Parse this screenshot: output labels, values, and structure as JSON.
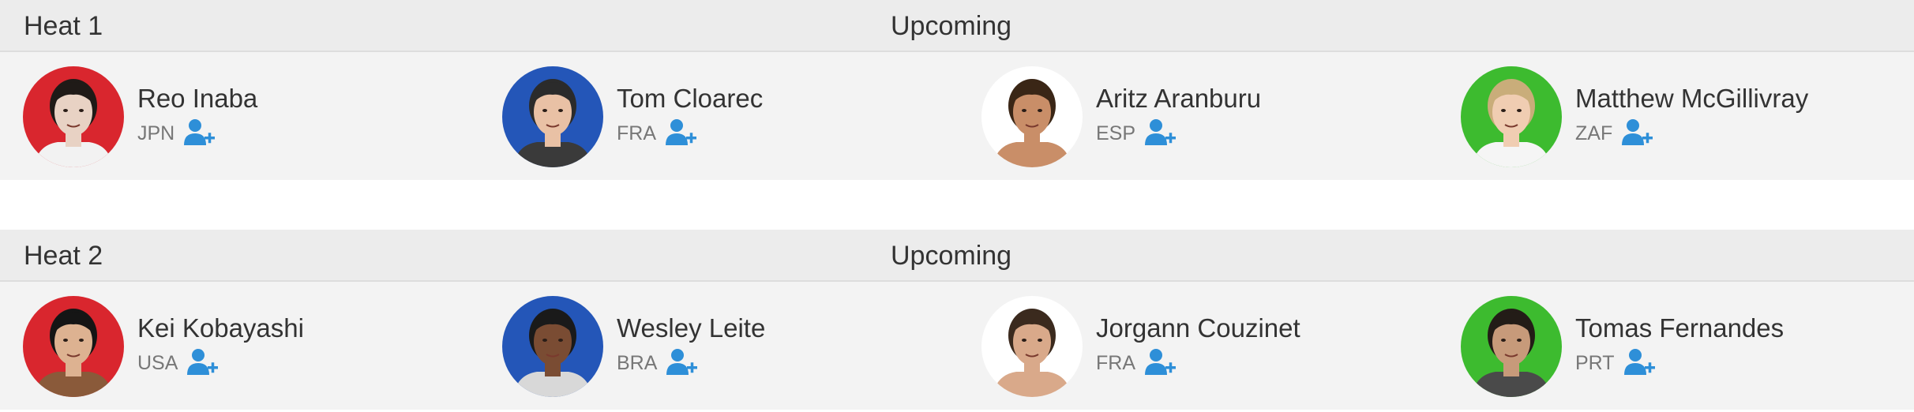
{
  "heats": [
    {
      "title": "Heat 1",
      "status": "Upcoming",
      "athletes": [
        {
          "name": "Reo Inaba",
          "country": "JPN",
          "jersey_color": "#d9262e",
          "avatar_bg": "#d9262e",
          "skin": "#e8d2c4",
          "hair": "#1f1a17",
          "shirt": "#f2f2f2"
        },
        {
          "name": "Tom Cloarec",
          "country": "FRA",
          "jersey_color": "#2456b8",
          "avatar_bg": "#2456b8",
          "skin": "#e9c1a5",
          "hair": "#2b2b2b",
          "shirt": "#3a3a3a"
        },
        {
          "name": "Aritz Aranburu",
          "country": "ESP",
          "jersey_color": "#ffffff",
          "avatar_bg": "#ffffff",
          "skin": "#c98e68",
          "hair": "#3a2616",
          "shirt": "#c98e68"
        },
        {
          "name": "Matthew McGillivray",
          "country": "ZAF",
          "jersey_color": "#3dbb2f",
          "avatar_bg": "#3dbb2f",
          "skin": "#f0cdb2",
          "hair": "#c9ad7a",
          "shirt": "#f5f5f5"
        }
      ]
    },
    {
      "title": "Heat 2",
      "status": "Upcoming",
      "athletes": [
        {
          "name": "Kei Kobayashi",
          "country": "USA",
          "jersey_color": "#d9262e",
          "avatar_bg": "#d9262e",
          "skin": "#ddb291",
          "hair": "#151515",
          "shirt": "#8a5a3a"
        },
        {
          "name": "Wesley Leite",
          "country": "BRA",
          "jersey_color": "#2456b8",
          "avatar_bg": "#2456b8",
          "skin": "#7a4c33",
          "hair": "#1a1a1a",
          "shirt": "#d8d8d8"
        },
        {
          "name": "Jorgann Couzinet",
          "country": "FRA",
          "jersey_color": "#ffffff",
          "avatar_bg": "#ffffff",
          "skin": "#d9a98a",
          "hair": "#3b2a1e",
          "shirt": "#d9a98a"
        },
        {
          "name": "Tomas Fernandes",
          "country": "PRT",
          "jersey_color": "#3dbb2f",
          "avatar_bg": "#3dbb2f",
          "skin": "#c79a7a",
          "hair": "#231c17",
          "shirt": "#4a4a4a"
        }
      ]
    }
  ],
  "icons": {
    "follow": "add-user-icon",
    "follow_color": "#2e8fd8"
  }
}
